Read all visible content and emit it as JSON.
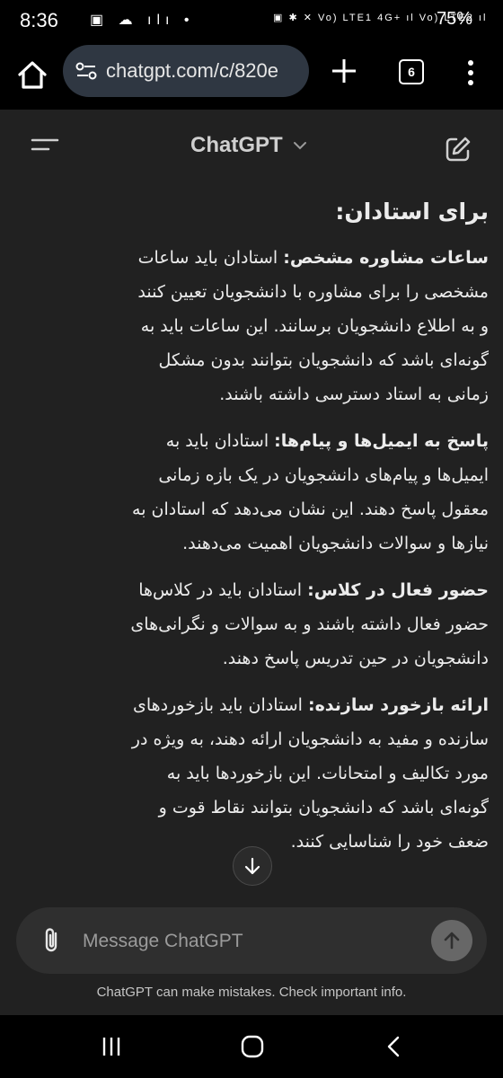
{
  "status": {
    "time": "8:36",
    "left_icons": "▣ ☁ ılı •",
    "right_icons": "▣ ✱ ✕ Vo) LTE1 4G+ ıl Vo) LTE2 ıl",
    "battery": "75%"
  },
  "browser": {
    "url": "chatgpt.com/c/820e",
    "tab_count": "6"
  },
  "app": {
    "title": "ChatGPT"
  },
  "content": {
    "heading": "برای استادان:",
    "items": [
      {
        "term": "ساعات مشاوره مشخص:",
        "text": " استادان باید ساعات مشخصی را برای مشاوره با دانشجویان تعیین کنند و به اطلاع دانشجویان برسانند. این ساعات باید به گونه‌ای باشد که دانشجویان بتوانند بدون مشکل زمانی به استاد دسترسی داشته باشند."
      },
      {
        "term": "پاسخ به ایمیل‌ها و پیام‌ها:",
        "text": " استادان باید به ایمیل‌ها و پیام‌های دانشجویان در یک بازه زمانی معقول پاسخ دهند. این نشان می‌دهد که استادان به نیازها و سوالات دانشجویان اهمیت می‌دهند."
      },
      {
        "term": "حضور فعال در کلاس:",
        "text": " استادان باید در کلاس‌ها حضور فعال داشته باشند و به سوالات و نگرانی‌های دانشجویان در حین تدریس پاسخ دهند."
      },
      {
        "term": "ارائه بازخورد سازنده:",
        "text": " استادان باید بازخوردهای سازنده و مفید به دانشجویان ارائه دهند، به ویژه در مورد تکالیف و امتحانات. این بازخوردها باید به گونه‌ای باشد که دانشجویان بتوانند نقاط قوت و ضعف خود را شناسایی کنند."
      }
    ]
  },
  "composer": {
    "placeholder": "Message ChatGPT"
  },
  "disclaimer": "ChatGPT can make mistakes. Check important info.",
  "colors": {
    "background": "#212121",
    "composer": "#2f2f2f",
    "urlbar": "#2f3742",
    "send_button": "#676767"
  },
  "icons": {
    "home": "home-icon",
    "tune": "site-settings-icon",
    "new_tab": "plus-icon",
    "tabs": "tab-switcher-icon",
    "menu": "more-vert-icon",
    "sidebar": "hamburger-icon",
    "model": "chevron-down-icon",
    "new_chat": "edit-icon",
    "scroll": "arrow-down-icon",
    "attach": "paperclip-icon",
    "send": "arrow-up-icon"
  }
}
